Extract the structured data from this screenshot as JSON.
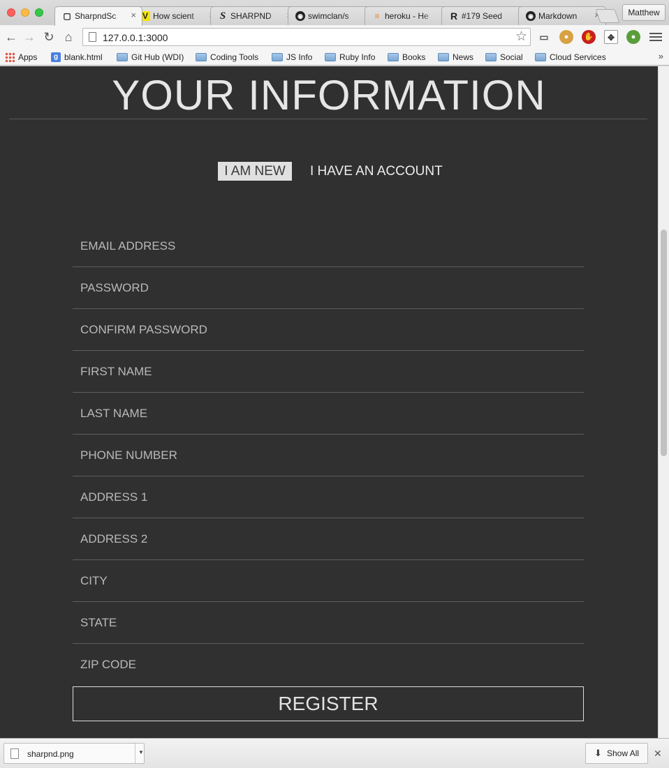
{
  "browser": {
    "tabs": [
      {
        "label": "SharpndSc",
        "icon": "page-icon",
        "active": true
      },
      {
        "label": "How scient",
        "icon": "v-icon",
        "active": false
      },
      {
        "label": "SHARPND",
        "icon": "s-logo-icon",
        "active": false
      },
      {
        "label": "swimclan/s",
        "icon": "github-icon",
        "active": false
      },
      {
        "label": "heroku - He",
        "icon": "stackoverflow-icon",
        "active": false
      },
      {
        "label": "#179 Seed",
        "icon": "railscasts-icon",
        "active": false
      },
      {
        "label": "Markdown",
        "icon": "github-icon",
        "active": false
      }
    ],
    "profile_name": "Matthew",
    "url": "127.0.0.1:3000",
    "bookmarks": [
      {
        "label": "Apps",
        "icon": "apps-grid-icon"
      },
      {
        "label": "blank.html",
        "icon": "google-icon"
      },
      {
        "label": "Git Hub (WDI)",
        "icon": "folder-icon"
      },
      {
        "label": "Coding Tools",
        "icon": "folder-icon"
      },
      {
        "label": "JS Info",
        "icon": "folder-icon"
      },
      {
        "label": "Ruby Info",
        "icon": "folder-icon"
      },
      {
        "label": "Books",
        "icon": "folder-icon"
      },
      {
        "label": "News",
        "icon": "folder-icon"
      },
      {
        "label": "Social",
        "icon": "folder-icon"
      },
      {
        "label": "Cloud Services",
        "icon": "folder-icon"
      }
    ],
    "bookmarks_overflow": "»"
  },
  "page": {
    "title": "YOUR INFORMATION",
    "toggle_new": "I AM NEW",
    "toggle_account": "I HAVE AN ACCOUNT",
    "fields": {
      "email": "EMAIL ADDRESS",
      "password": "PASSWORD",
      "confirm_password": "CONFIRM PASSWORD",
      "first_name": "FIRST NAME",
      "last_name": "LAST NAME",
      "phone": "PHONE NUMBER",
      "address1": "ADDRESS 1",
      "address2": "ADDRESS 2",
      "city": "CITY",
      "state": "STATE",
      "zip": "ZIP CODE"
    },
    "register_label": "REGISTER"
  },
  "downloads": {
    "file_name": "sharpnd.png",
    "show_all": "Show All"
  },
  "colors": {
    "page_background": "#303030",
    "toggle_active_background": "#e0e0e0",
    "text_light": "#e6e6e6"
  }
}
